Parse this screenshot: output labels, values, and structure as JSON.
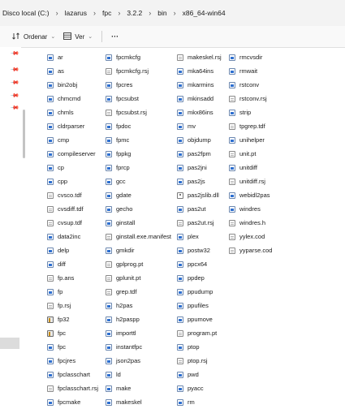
{
  "breadcrumb": [
    "Disco local (C:)",
    "lazarus",
    "fpc",
    "3.2.2",
    "bin",
    "x86_64-win64"
  ],
  "toolbar": {
    "sort_label": "Ordenar",
    "view_label": "Ver",
    "more_label": "···"
  },
  "columns": [
    [
      {
        "name": "ar",
        "icon": "exe-icon"
      },
      {
        "name": "as",
        "icon": "exe-icon"
      },
      {
        "name": "bin2obj",
        "icon": "exe-icon"
      },
      {
        "name": "chmcmd",
        "icon": "exe-icon"
      },
      {
        "name": "chmls",
        "icon": "exe-icon"
      },
      {
        "name": "cldrparser",
        "icon": "exe-icon"
      },
      {
        "name": "cmp",
        "icon": "exe-icon"
      },
      {
        "name": "compileserver",
        "icon": "exe-icon"
      },
      {
        "name": "cp",
        "icon": "exe-icon"
      },
      {
        "name": "cpp",
        "icon": "exe-icon"
      },
      {
        "name": "cvsco.tdf",
        "icon": "doc-icon"
      },
      {
        "name": "cvsdiff.tdf",
        "icon": "doc-icon"
      },
      {
        "name": "cvsup.tdf",
        "icon": "doc-icon"
      },
      {
        "name": "data2inc",
        "icon": "exe-icon"
      },
      {
        "name": "delp",
        "icon": "exe-icon"
      },
      {
        "name": "diff",
        "icon": "exe-icon"
      },
      {
        "name": "fp.ans",
        "icon": "doc-icon"
      },
      {
        "name": "fp",
        "icon": "exe-icon"
      },
      {
        "name": "fp.rsj",
        "icon": "doc-icon"
      },
      {
        "name": "fp32",
        "icon": "special-icon"
      },
      {
        "name": "fpc",
        "icon": "special-icon"
      },
      {
        "name": "fpc",
        "icon": "exe-icon"
      },
      {
        "name": "fpcjres",
        "icon": "exe-icon"
      },
      {
        "name": "fpclasschart",
        "icon": "exe-icon"
      },
      {
        "name": "fpclasschart.rsj",
        "icon": "doc-icon"
      },
      {
        "name": "fpcmake",
        "icon": "exe-icon"
      }
    ],
    [
      {
        "name": "fpcmkcfg",
        "icon": "exe-icon"
      },
      {
        "name": "fpcmkcfg.rsj",
        "icon": "doc-icon"
      },
      {
        "name": "fpcres",
        "icon": "exe-icon"
      },
      {
        "name": "fpcsubst",
        "icon": "exe-icon"
      },
      {
        "name": "fpcsubst.rsj",
        "icon": "doc-icon"
      },
      {
        "name": "fpdoc",
        "icon": "exe-icon"
      },
      {
        "name": "fpmc",
        "icon": "exe-icon"
      },
      {
        "name": "fppkg",
        "icon": "exe-icon"
      },
      {
        "name": "fprcp",
        "icon": "exe-icon"
      },
      {
        "name": "gcc",
        "icon": "exe-icon"
      },
      {
        "name": "gdate",
        "icon": "exe-icon"
      },
      {
        "name": "gecho",
        "icon": "exe-icon"
      },
      {
        "name": "ginstall",
        "icon": "exe-icon"
      },
      {
        "name": "ginstall.exe.manifest",
        "icon": "doc-icon"
      },
      {
        "name": "gmkdir",
        "icon": "exe-icon"
      },
      {
        "name": "gplprog.pt",
        "icon": "doc-icon"
      },
      {
        "name": "gplunit.pt",
        "icon": "doc-icon"
      },
      {
        "name": "grep.tdf",
        "icon": "doc-icon"
      },
      {
        "name": "h2pas",
        "icon": "exe-icon"
      },
      {
        "name": "h2paspp",
        "icon": "exe-icon"
      },
      {
        "name": "importtl",
        "icon": "exe-icon"
      },
      {
        "name": "instantfpc",
        "icon": "exe-icon"
      },
      {
        "name": "json2pas",
        "icon": "exe-icon"
      },
      {
        "name": "ld",
        "icon": "exe-icon"
      },
      {
        "name": "make",
        "icon": "exe-icon"
      },
      {
        "name": "makeskel",
        "icon": "exe-icon"
      }
    ],
    [
      {
        "name": "makeskel.rsj",
        "icon": "doc-icon"
      },
      {
        "name": "mka64ins",
        "icon": "exe-icon"
      },
      {
        "name": "mkarmins",
        "icon": "exe-icon"
      },
      {
        "name": "mkinsadd",
        "icon": "exe-icon"
      },
      {
        "name": "mkx86ins",
        "icon": "exe-icon"
      },
      {
        "name": "mv",
        "icon": "exe-icon"
      },
      {
        "name": "objdump",
        "icon": "exe-icon"
      },
      {
        "name": "pas2fpm",
        "icon": "exe-icon"
      },
      {
        "name": "pas2jni",
        "icon": "exe-icon"
      },
      {
        "name": "pas2js",
        "icon": "exe-icon"
      },
      {
        "name": "pas2jslib.dll",
        "icon": "dll-icon"
      },
      {
        "name": "pas2ut",
        "icon": "exe-icon"
      },
      {
        "name": "pas2ut.rsj",
        "icon": "doc-icon"
      },
      {
        "name": "plex",
        "icon": "exe-icon"
      },
      {
        "name": "postw32",
        "icon": "exe-icon"
      },
      {
        "name": "ppcx64",
        "icon": "exe-icon"
      },
      {
        "name": "ppdep",
        "icon": "exe-icon"
      },
      {
        "name": "ppudump",
        "icon": "exe-icon"
      },
      {
        "name": "ppufiles",
        "icon": "exe-icon"
      },
      {
        "name": "ppumove",
        "icon": "exe-icon"
      },
      {
        "name": "program.pt",
        "icon": "doc-icon"
      },
      {
        "name": "ptop",
        "icon": "exe-icon"
      },
      {
        "name": "ptop.rsj",
        "icon": "doc-icon"
      },
      {
        "name": "pwd",
        "icon": "exe-icon"
      },
      {
        "name": "pyacc",
        "icon": "exe-icon"
      },
      {
        "name": "rm",
        "icon": "exe-icon"
      }
    ],
    [
      {
        "name": "rmcvsdir",
        "icon": "exe-icon"
      },
      {
        "name": "rmwait",
        "icon": "exe-icon"
      },
      {
        "name": "rstconv",
        "icon": "exe-icon"
      },
      {
        "name": "rstconv.rsj",
        "icon": "doc-icon"
      },
      {
        "name": "strip",
        "icon": "exe-icon"
      },
      {
        "name": "tpgrep.tdf",
        "icon": "doc-icon"
      },
      {
        "name": "unihelper",
        "icon": "exe-icon"
      },
      {
        "name": "unit.pt",
        "icon": "doc-icon"
      },
      {
        "name": "unitdiff",
        "icon": "exe-icon"
      },
      {
        "name": "unitdiff.rsj",
        "icon": "doc-icon"
      },
      {
        "name": "webidl2pas",
        "icon": "exe-icon"
      },
      {
        "name": "windres",
        "icon": "exe-icon"
      },
      {
        "name": "windres.h",
        "icon": "doc-icon"
      },
      {
        "name": "yylex.cod",
        "icon": "doc-icon"
      },
      {
        "name": "yyparse.cod",
        "icon": "doc-icon"
      }
    ]
  ]
}
